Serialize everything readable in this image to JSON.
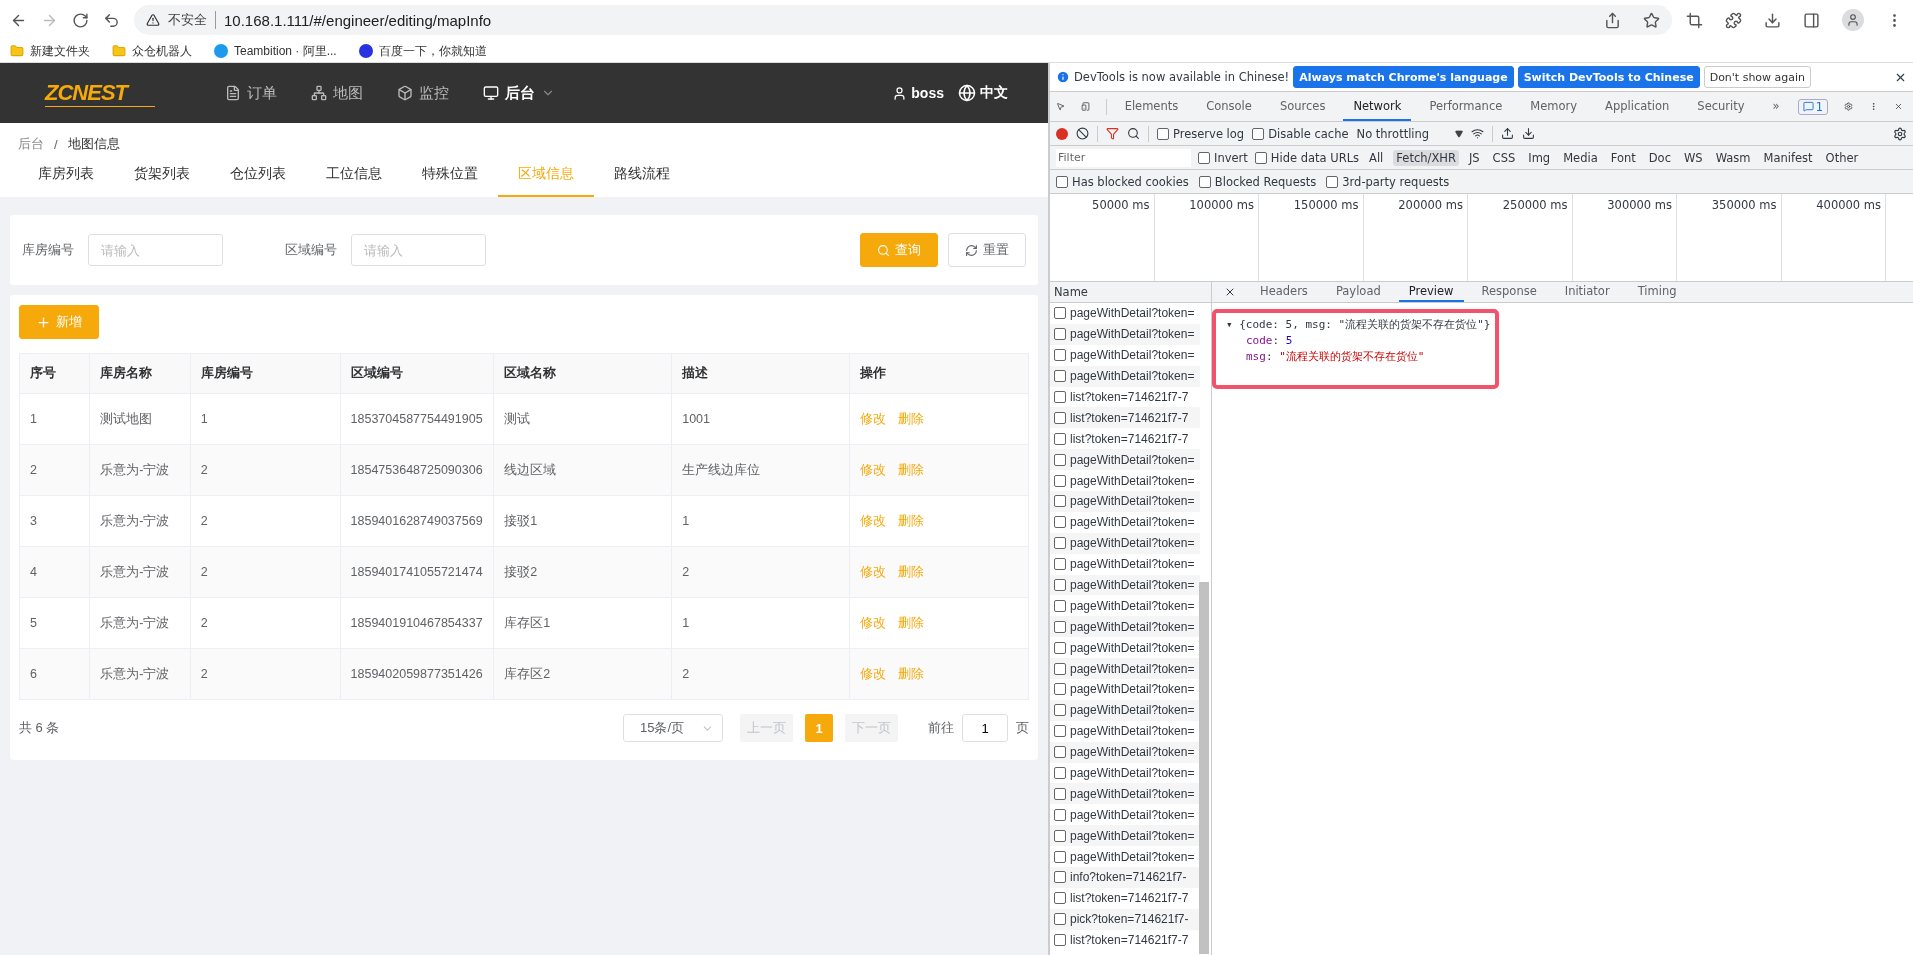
{
  "browser": {
    "nav_buttons": [
      {
        "kind": "back",
        "disabled": false
      },
      {
        "kind": "forward",
        "disabled": true
      },
      {
        "kind": "reload",
        "disabled": false
      },
      {
        "kind": "undo",
        "disabled": false
      }
    ],
    "address": {
      "security_label": "不安全",
      "url": "10.168.1.111/#/engineer/editing/mapInfo"
    },
    "bookmarks": [
      {
        "label": "新建文件夹",
        "kind": "folder"
      },
      {
        "label": "众仓机器人",
        "kind": "folder"
      },
      {
        "label": "Teambition · 阿里...",
        "kind": "teambition"
      },
      {
        "label": "百度一下，你就知道",
        "kind": "baidu"
      }
    ]
  },
  "app": {
    "logo": "ZCNEST",
    "nav": [
      {
        "label": "订单",
        "kind": "file",
        "selected": false
      },
      {
        "label": "地图",
        "kind": "sitemap",
        "selected": false
      },
      {
        "label": "监控",
        "kind": "cube",
        "selected": false
      },
      {
        "label": "后台",
        "kind": "monitor",
        "selected": true
      }
    ],
    "user": "boss",
    "language": "中文",
    "breadcrumb": [
      "后台",
      "地图信息"
    ],
    "breadcrumb_separator": "/",
    "tabs": [
      {
        "label": "库房列表",
        "selected": false
      },
      {
        "label": "货架列表",
        "selected": false
      },
      {
        "label": "仓位列表",
        "selected": false
      },
      {
        "label": "工位信息",
        "selected": false
      },
      {
        "label": "特殊位置",
        "selected": false
      },
      {
        "label": "区域信息",
        "selected": true
      },
      {
        "label": "路线流程",
        "selected": false
      }
    ],
    "search_fields": [
      {
        "label": "库房编号",
        "placeholder": "请输入"
      },
      {
        "label": "区域编号",
        "placeholder": "请输入"
      }
    ],
    "query_button": "查询",
    "reset_button": "重置",
    "add_button": "新增",
    "table": {
      "columns": [
        "序号",
        "库房名称",
        "库房编号",
        "区域编号",
        "区域名称",
        "描述",
        "操作"
      ],
      "rows": [
        {
          "cells": [
            "1",
            "测试地图",
            "1",
            "1853704587754491905",
            "测试",
            "1001"
          ],
          "actions": [
            "修改",
            "删除"
          ]
        },
        {
          "cells": [
            "2",
            "乐意为-宁波",
            "2",
            "1854753648725090306",
            "线边区域",
            "生产线边库位"
          ],
          "actions": [
            "修改",
            "删除"
          ]
        },
        {
          "cells": [
            "3",
            "乐意为-宁波",
            "2",
            "1859401628749037569",
            "接驳1",
            "1"
          ],
          "actions": [
            "修改",
            "删除"
          ]
        },
        {
          "cells": [
            "4",
            "乐意为-宁波",
            "2",
            "1859401741055721474",
            "接驳2",
            "2"
          ],
          "actions": [
            "修改",
            "删除"
          ]
        },
        {
          "cells": [
            "5",
            "乐意为-宁波",
            "2",
            "1859401910467854337",
            "库存区1",
            "1"
          ],
          "actions": [
            "修改",
            "删除"
          ]
        },
        {
          "cells": [
            "6",
            "乐意为-宁波",
            "2",
            "1859402059877351426",
            "库存区2",
            "2"
          ],
          "actions": [
            "修改",
            "删除"
          ]
        }
      ]
    },
    "pagination": {
      "total": "共 6 条",
      "page_size": "15条/页",
      "prev": {
        "label": "上一页",
        "disabled": true
      },
      "pages": [
        {
          "label": "1",
          "selected": true
        }
      ],
      "next": {
        "label": "下一页",
        "disabled": true
      },
      "goto_label": "前往",
      "goto_value": "1",
      "goto_suffix": "页"
    }
  },
  "devtools": {
    "infobar": {
      "message": "DevTools is now available in Chinese!",
      "buttons": [
        {
          "label": "Always match Chrome's language",
          "kind": "primary"
        },
        {
          "label": "Switch DevTools to Chinese",
          "kind": "primary"
        },
        {
          "label": "Don't show again",
          "kind": "secondary"
        }
      ]
    },
    "tabs": [
      {
        "label": "Elements",
        "selected": false
      },
      {
        "label": "Console",
        "selected": false
      },
      {
        "label": "Sources",
        "selected": false
      },
      {
        "label": "Network",
        "selected": true
      },
      {
        "label": "Performance",
        "selected": false
      },
      {
        "label": "Memory",
        "selected": false
      },
      {
        "label": "Application",
        "selected": false
      },
      {
        "label": "Security",
        "selected": false
      }
    ],
    "more_tabs": "»",
    "issues_badge": "1",
    "toolbar": {
      "recording": true,
      "checkboxes": [
        {
          "label": "Preserve log",
          "checked": false
        },
        {
          "label": "Disable cache",
          "checked": false
        }
      ],
      "throttling": "No throttling"
    },
    "filter": {
      "placeholder": "Filter",
      "checkboxes": [
        {
          "label": "Invert",
          "checked": false
        },
        {
          "label": "Hide data URLs",
          "checked": false
        }
      ],
      "types": [
        {
          "label": "All",
          "selected": false
        },
        {
          "label": "Fetch/XHR",
          "selected": true
        },
        {
          "label": "JS",
          "selected": false
        },
        {
          "label": "CSS",
          "selected": false
        },
        {
          "label": "Img",
          "selected": false
        },
        {
          "label": "Media",
          "selected": false
        },
        {
          "label": "Font",
          "selected": false
        },
        {
          "label": "Doc",
          "selected": false
        },
        {
          "label": "WS",
          "selected": false
        },
        {
          "label": "Wasm",
          "selected": false
        },
        {
          "label": "Manifest",
          "selected": false
        },
        {
          "label": "Other",
          "selected": false
        }
      ]
    },
    "blocked_filters": [
      {
        "label": "Has blocked cookies",
        "checked": false
      },
      {
        "label": "Blocked Requests",
        "checked": false
      },
      {
        "label": "3rd-party requests",
        "checked": false
      }
    ],
    "timeline_ticks": [
      "50000 ms",
      "100000 ms",
      "150000 ms",
      "200000 ms",
      "250000 ms",
      "300000 ms",
      "350000 ms",
      "400000 ms"
    ],
    "name_header": "Name",
    "requests": [
      "pageWithDetail?token=",
      "pageWithDetail?token=",
      "pageWithDetail?token=",
      "pageWithDetail?token=",
      "list?token=714621f7-7",
      "list?token=714621f7-7",
      "list?token=714621f7-7",
      "pageWithDetail?token=",
      "pageWithDetail?token=",
      "pageWithDetail?token=",
      "pageWithDetail?token=",
      "pageWithDetail?token=",
      "pageWithDetail?token=",
      "pageWithDetail?token=",
      "pageWithDetail?token=",
      "pageWithDetail?token=",
      "pageWithDetail?token=",
      "pageWithDetail?token=",
      "pageWithDetail?token=",
      "pageWithDetail?token=",
      "pageWithDetail?token=",
      "pageWithDetail?token=",
      "pageWithDetail?token=",
      "pageWithDetail?token=",
      "pageWithDetail?token=",
      "pageWithDetail?token=",
      "pageWithDetail?token=",
      "info?token=714621f7-",
      "list?token=714621f7-7",
      "pick?token=714621f7-",
      "list?token=714621f7-7"
    ],
    "detail_tabs": [
      {
        "label": "Headers",
        "selected": false
      },
      {
        "label": "Payload",
        "selected": false
      },
      {
        "label": "Preview",
        "selected": true
      },
      {
        "label": "Response",
        "selected": false
      },
      {
        "label": "Initiator",
        "selected": false
      },
      {
        "label": "Timing",
        "selected": false
      }
    ],
    "preview": {
      "expand_arrow": "▾",
      "key_separator": ":",
      "summary": "{code: 5, msg: \"流程关联的货架不存在货位\"}",
      "fields": [
        {
          "key": "code",
          "value": "5",
          "kind": "number"
        },
        {
          "key": "msg",
          "value": "\"流程关联的货架不存在货位\"",
          "kind": "string"
        }
      ]
    }
  }
}
